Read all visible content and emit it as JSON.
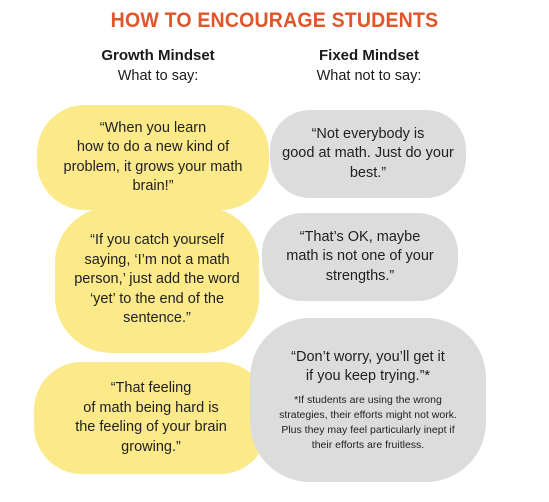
{
  "title": "HOW TO ENCOURAGE STUDENTS",
  "columns": [
    {
      "heading": "Growth Mindset",
      "subheading": "What to say:"
    },
    {
      "heading": "Fixed Mindset",
      "subheading": "What not to say:"
    }
  ],
  "growth_quotes": [
    [
      "“When you learn",
      "how to do a new kind of",
      "problem, it grows your math",
      "brain!”"
    ],
    [
      "“If you catch yourself",
      "saying, ‘I’m not a math",
      "person,’ just add the word",
      "‘yet’ to the end of the",
      "sentence.”"
    ],
    [
      "“That feeling",
      "of math being hard is",
      "the feeling of your brain",
      "growing.”"
    ]
  ],
  "fixed_quotes": [
    [
      "“Not everybody is",
      "good at math. Just do your",
      "best.”"
    ],
    [
      "“That’s OK, maybe",
      "math is not one of your",
      "strengths.”"
    ],
    [
      "“Don’t worry, you’ll get it",
      "if you keep trying.”*"
    ]
  ],
  "footnote": [
    "*If students are using the wrong",
    "strategies, their efforts might not work.",
    "Plus they may feel particularly inept if",
    "their efforts are fruitless."
  ],
  "colors": {
    "title": "#e0562a",
    "growth_bubble": "#fbe98a",
    "fixed_bubble": "#dcdcdd"
  }
}
